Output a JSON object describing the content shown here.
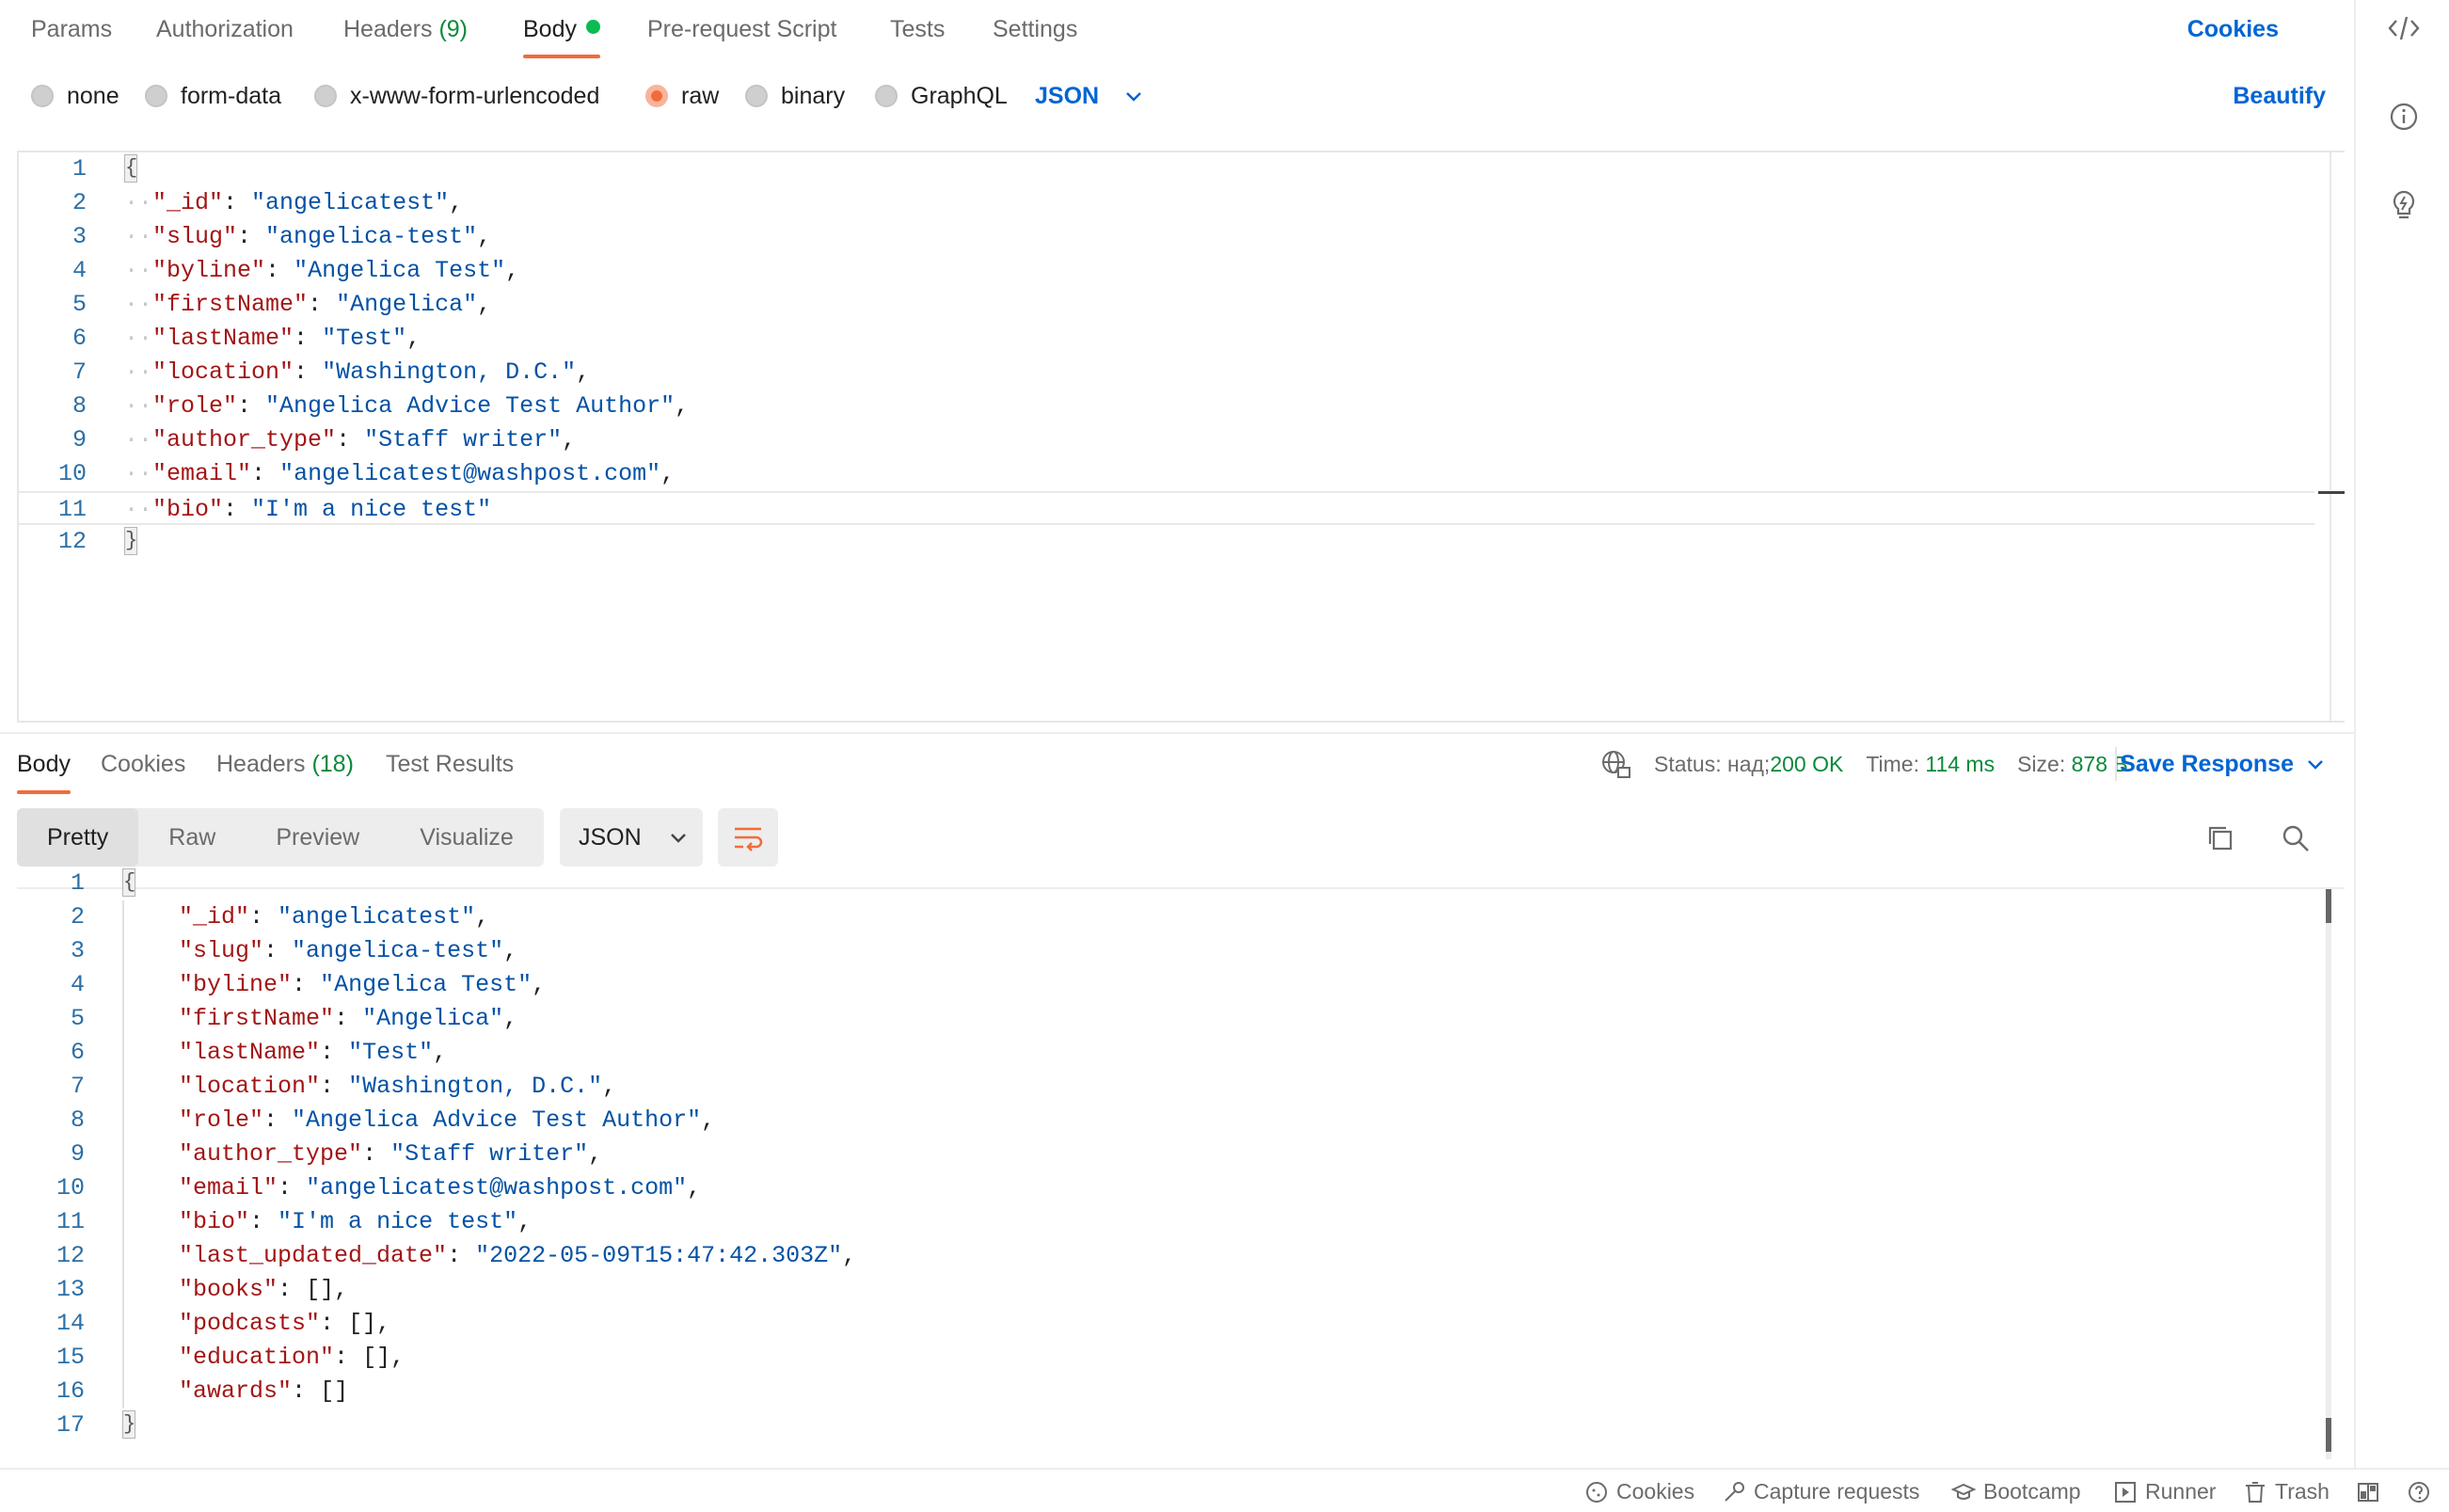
{
  "request_tabs": [
    {
      "label": "Params"
    },
    {
      "label": "Authorization"
    },
    {
      "label": "Headers",
      "count": "(9)"
    },
    {
      "label": "Body"
    },
    {
      "label": "Pre-request Script"
    },
    {
      "label": "Tests"
    },
    {
      "label": "Settings"
    }
  ],
  "cookies_label": "Cookies",
  "body_types": [
    "none",
    "form-data",
    "x-www-form-urlencoded",
    "raw",
    "binary",
    "GraphQL"
  ],
  "body_format": "JSON",
  "beautify_label": "Beautify",
  "request_body": [
    {
      "n": "1",
      "brace": "{"
    },
    {
      "n": "2",
      "key": "\"_id\"",
      "val": "\"angelicatest\"",
      "end": ","
    },
    {
      "n": "3",
      "key": "\"slug\"",
      "val": "\"angelica-test\"",
      "end": ","
    },
    {
      "n": "4",
      "key": "\"byline\"",
      "val": "\"Angelica Test\"",
      "end": ","
    },
    {
      "n": "5",
      "key": "\"firstName\"",
      "val": "\"Angelica\"",
      "end": ","
    },
    {
      "n": "6",
      "key": "\"lastName\"",
      "val": "\"Test\"",
      "end": ","
    },
    {
      "n": "7",
      "key": "\"location\"",
      "val": "\"Washington, D.C.\"",
      "end": ","
    },
    {
      "n": "8",
      "key": "\"role\"",
      "val": "\"Angelica Advice Test Author\"",
      "end": ","
    },
    {
      "n": "9",
      "key": "\"author_type\"",
      "val": "\"Staff writer\"",
      "end": ","
    },
    {
      "n": "10",
      "key": "\"email\"",
      "val": "\"angelicatest@washpost.com\"",
      "end": ","
    },
    {
      "n": "11",
      "key": "\"bio\"",
      "val": "\"I'm a nice test\"",
      "end": ""
    },
    {
      "n": "12",
      "brace": "}"
    }
  ],
  "response_tabs": [
    {
      "label": "Body"
    },
    {
      "label": "Cookies"
    },
    {
      "label": "Headers",
      "count": "(18)"
    },
    {
      "label": "Test Results"
    }
  ],
  "status": {
    "label": "Status:",
    "value": "200 OK",
    "time_label": "Time:",
    "time": "114 ms",
    "size_label": "Size:",
    "size": "878 B"
  },
  "save_response_label": "Save Response",
  "view_modes": [
    "Pretty",
    "Raw",
    "Preview",
    "Visualize"
  ],
  "response_format": "JSON",
  "response_body": [
    {
      "n": "1",
      "brace": "{"
    },
    {
      "n": "2",
      "key": "\"_id\"",
      "val": "\"angelicatest\"",
      "end": ","
    },
    {
      "n": "3",
      "key": "\"slug\"",
      "val": "\"angelica-test\"",
      "end": ","
    },
    {
      "n": "4",
      "key": "\"byline\"",
      "val": "\"Angelica Test\"",
      "end": ","
    },
    {
      "n": "5",
      "key": "\"firstName\"",
      "val": "\"Angelica\"",
      "end": ","
    },
    {
      "n": "6",
      "key": "\"lastName\"",
      "val": "\"Test\"",
      "end": ","
    },
    {
      "n": "7",
      "key": "\"location\"",
      "val": "\"Washington, D.C.\"",
      "end": ","
    },
    {
      "n": "8",
      "key": "\"role\"",
      "val": "\"Angelica Advice Test Author\"",
      "end": ","
    },
    {
      "n": "9",
      "key": "\"author_type\"",
      "val": "\"Staff writer\"",
      "end": ","
    },
    {
      "n": "10",
      "key": "\"email\"",
      "val": "\"angelicatest@washpost.com\"",
      "end": ","
    },
    {
      "n": "11",
      "key": "\"bio\"",
      "val": "\"I'm a nice test\"",
      "end": ","
    },
    {
      "n": "12",
      "key": "\"last_updated_date\"",
      "val": "\"2022-05-09T15:47:42.303Z\"",
      "end": ","
    },
    {
      "n": "13",
      "key": "\"books\"",
      "arr": "[]",
      "end": ","
    },
    {
      "n": "14",
      "key": "\"podcasts\"",
      "arr": "[]",
      "end": ","
    },
    {
      "n": "15",
      "key": "\"education\"",
      "arr": "[]",
      "end": ","
    },
    {
      "n": "16",
      "key": "\"awards\"",
      "arr": "[]",
      "end": ""
    },
    {
      "n": "17",
      "brace": "}"
    }
  ],
  "footer": [
    "Cookies",
    "Capture requests",
    "Bootcamp",
    "Runner",
    "Trash"
  ],
  "colors": {
    "accent": "#f26b3a",
    "link": "#0265d2",
    "success": "#0a8a3a",
    "json_key": "#a31515",
    "json_string": "#0451a5"
  },
  "icons": [
    "code-icon",
    "info-icon",
    "bulb-icon",
    "globe-lock-icon",
    "chevron-down-icon",
    "wrap-lines-icon",
    "copy-icon",
    "search-icon",
    "cookie-icon",
    "capture-icon",
    "bootcamp-icon",
    "runner-icon",
    "trash-icon",
    "layout-icon",
    "help-icon"
  ]
}
